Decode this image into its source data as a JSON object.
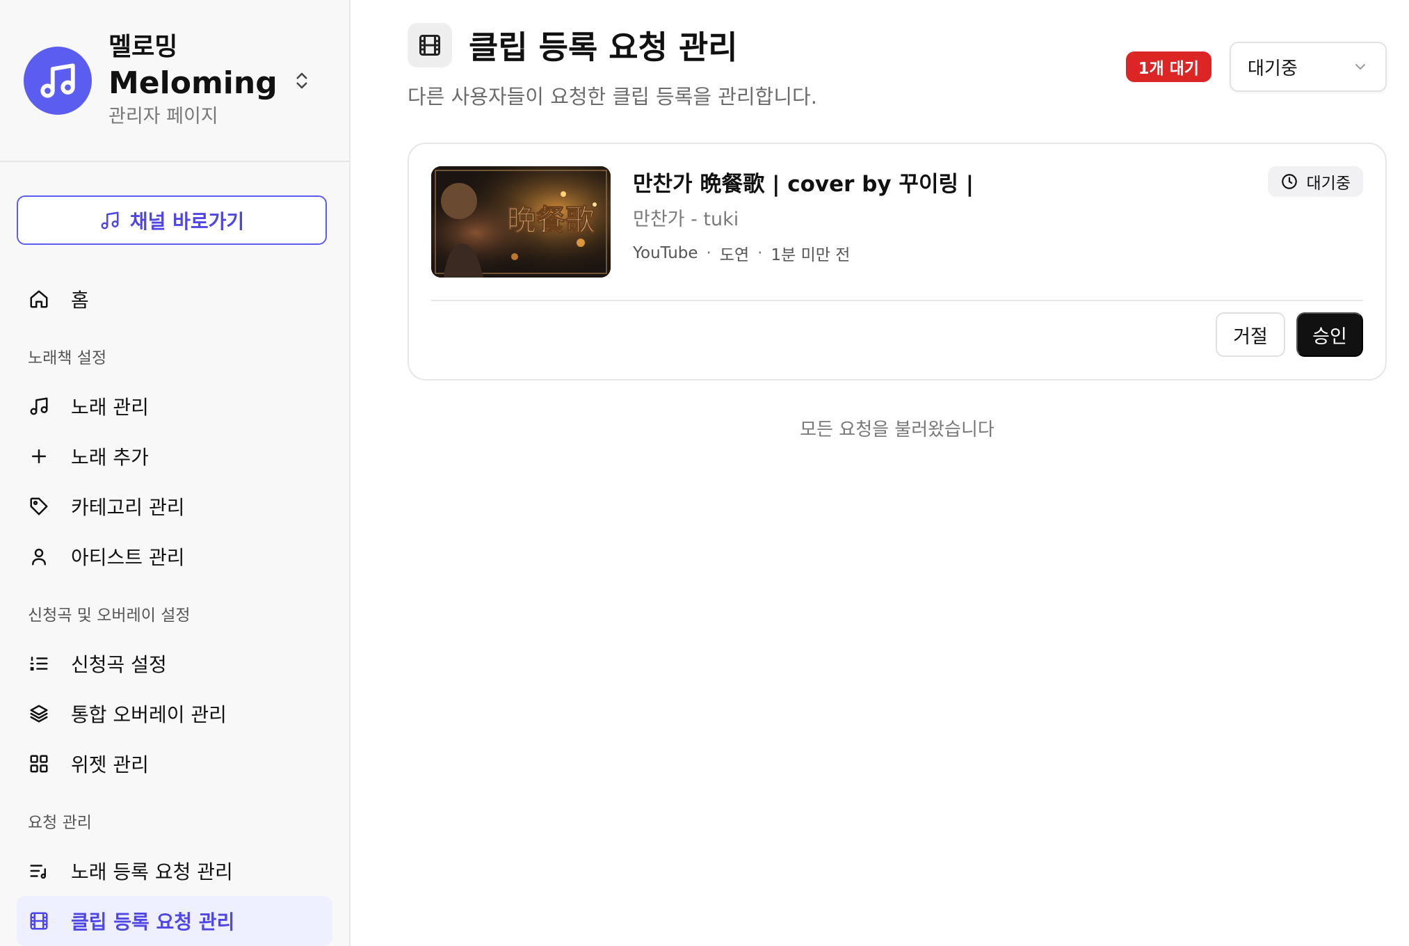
{
  "brand": {
    "name": "멜로밍",
    "name_en": "Meloming",
    "subtitle": "관리자 페이지",
    "color": "#5b5cf0"
  },
  "sidebar": {
    "channel_button": "채널 바로가기",
    "home": "홈",
    "sections": [
      {
        "title": "노래책 설정",
        "items": [
          {
            "label": "노래 관리",
            "icon": "music-note-icon"
          },
          {
            "label": "노래 추가",
            "icon": "plus-icon"
          },
          {
            "label": "카테고리 관리",
            "icon": "tag-icon"
          },
          {
            "label": "아티스트 관리",
            "icon": "user-icon"
          }
        ]
      },
      {
        "title": "신청곡 및 오버레이 설정",
        "items": [
          {
            "label": "신청곡 설정",
            "icon": "list-ordered-icon"
          },
          {
            "label": "통합 오버레이 관리",
            "icon": "layers-icon"
          },
          {
            "label": "위젯 관리",
            "icon": "grid-icon"
          }
        ]
      },
      {
        "title": "요청 관리",
        "items": [
          {
            "label": "노래 등록 요청 관리",
            "icon": "list-music-icon"
          },
          {
            "label": "클립 등록 요청 관리",
            "icon": "film-icon",
            "active": true
          }
        ]
      }
    ]
  },
  "header": {
    "title": "클립 등록 요청 관리",
    "description": "다른 사용자들이 요청한 클립 등록을 관리합니다.",
    "pending_badge": "1개 대기",
    "status_filter": "대기중"
  },
  "requests": [
    {
      "title": "만찬가 晩餐歌 | cover by 꾸이링 |",
      "subtitle": "만찬가 - tuki",
      "platform": "YouTube",
      "requester": "도연",
      "time": "1분 미만 전",
      "status": "대기중",
      "thumbnail_text": "晩餐歌",
      "reject_label": "거절",
      "approve_label": "승인"
    }
  ],
  "footer_message": "모든 요청을 불러왔습니다",
  "colors": {
    "accent": "#4f46e5",
    "danger": "#dc2626",
    "dark": "#111111"
  }
}
